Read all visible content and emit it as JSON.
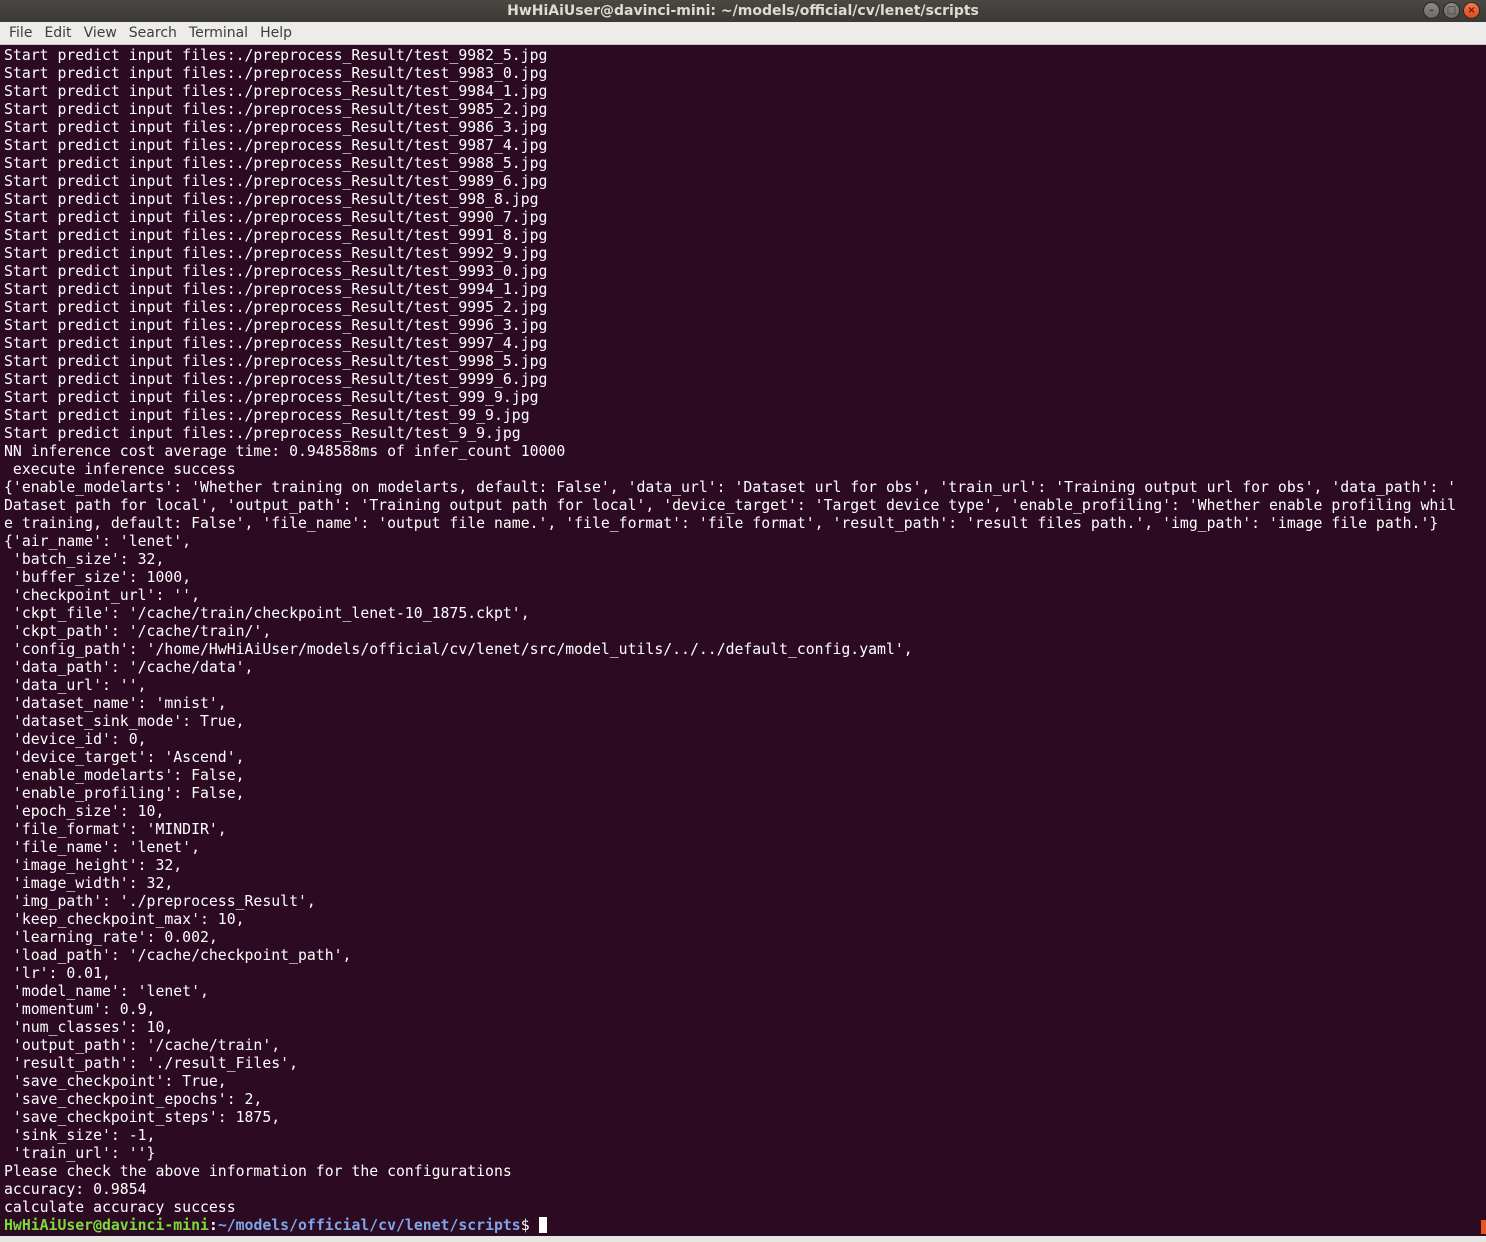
{
  "window": {
    "title": "HwHiAiUser@davinci-mini: ~/models/official/cv/lenet/scripts",
    "buttons": {
      "minimize": "minimize-icon",
      "maximize": "maximize-icon",
      "close": "close-icon"
    }
  },
  "menu": [
    "File",
    "Edit",
    "View",
    "Search",
    "Terminal",
    "Help"
  ],
  "terminal": {
    "lines": [
      "Start predict input files:./preprocess_Result/test_9982_5.jpg",
      "Start predict input files:./preprocess_Result/test_9983_0.jpg",
      "Start predict input files:./preprocess_Result/test_9984_1.jpg",
      "Start predict input files:./preprocess_Result/test_9985_2.jpg",
      "Start predict input files:./preprocess_Result/test_9986_3.jpg",
      "Start predict input files:./preprocess_Result/test_9987_4.jpg",
      "Start predict input files:./preprocess_Result/test_9988_5.jpg",
      "Start predict input files:./preprocess_Result/test_9989_6.jpg",
      "Start predict input files:./preprocess_Result/test_998_8.jpg",
      "Start predict input files:./preprocess_Result/test_9990_7.jpg",
      "Start predict input files:./preprocess_Result/test_9991_8.jpg",
      "Start predict input files:./preprocess_Result/test_9992_9.jpg",
      "Start predict input files:./preprocess_Result/test_9993_0.jpg",
      "Start predict input files:./preprocess_Result/test_9994_1.jpg",
      "Start predict input files:./preprocess_Result/test_9995_2.jpg",
      "Start predict input files:./preprocess_Result/test_9996_3.jpg",
      "Start predict input files:./preprocess_Result/test_9997_4.jpg",
      "Start predict input files:./preprocess_Result/test_9998_5.jpg",
      "Start predict input files:./preprocess_Result/test_9999_6.jpg",
      "Start predict input files:./preprocess_Result/test_999_9.jpg",
      "Start predict input files:./preprocess_Result/test_99_9.jpg",
      "Start predict input files:./preprocess_Result/test_9_9.jpg",
      "NN inference cost average time: 0.948588ms of infer_count 10000",
      " execute inference success",
      "{'enable_modelarts': 'Whether training on modelarts, default: False', 'data_url': 'Dataset url for obs', 'train_url': 'Training output url for obs', 'data_path': '",
      "Dataset path for local', 'output_path': 'Training output path for local', 'device_target': 'Target device type', 'enable_profiling': 'Whether enable profiling whil",
      "e training, default: False', 'file_name': 'output file name.', 'file_format': 'file format', 'result_path': 'result files path.', 'img_path': 'image file path.'}",
      "{'air_name': 'lenet',",
      " 'batch_size': 32,",
      " 'buffer_size': 1000,",
      " 'checkpoint_url': '',",
      " 'ckpt_file': '/cache/train/checkpoint_lenet-10_1875.ckpt',",
      " 'ckpt_path': '/cache/train/',",
      " 'config_path': '/home/HwHiAiUser/models/official/cv/lenet/src/model_utils/../../default_config.yaml',",
      " 'data_path': '/cache/data',",
      " 'data_url': '',",
      " 'dataset_name': 'mnist',",
      " 'dataset_sink_mode': True,",
      " 'device_id': 0,",
      " 'device_target': 'Ascend',",
      " 'enable_modelarts': False,",
      " 'enable_profiling': False,",
      " 'epoch_size': 10,",
      " 'file_format': 'MINDIR',",
      " 'file_name': 'lenet',",
      " 'image_height': 32,",
      " 'image_width': 32,",
      " 'img_path': './preprocess_Result',",
      " 'keep_checkpoint_max': 10,",
      " 'learning_rate': 0.002,",
      " 'load_path': '/cache/checkpoint_path',",
      " 'lr': 0.01,",
      " 'model_name': 'lenet',",
      " 'momentum': 0.9,",
      " 'num_classes': 10,",
      " 'output_path': '/cache/train',",
      " 'result_path': './result_Files',",
      " 'save_checkpoint': True,",
      " 'save_checkpoint_epochs': 2,",
      " 'save_checkpoint_steps': 1875,",
      " 'sink_size': -1,",
      " 'train_url': ''}",
      "Please check the above information for the configurations",
      "accuracy: 0.9854",
      "calculate accuracy success"
    ],
    "prompt": {
      "user_host": "HwHiAiUser@davinci-mini",
      "colon": ":",
      "path": "~/models/official/cv/lenet/scripts",
      "symbol": "$"
    }
  },
  "colors": {
    "background": "#2c0a22",
    "text": "#ffffff",
    "prompt_user": "#7ddc3c",
    "prompt_path": "#7da6e8",
    "scroll_thumb": "#e95420"
  }
}
